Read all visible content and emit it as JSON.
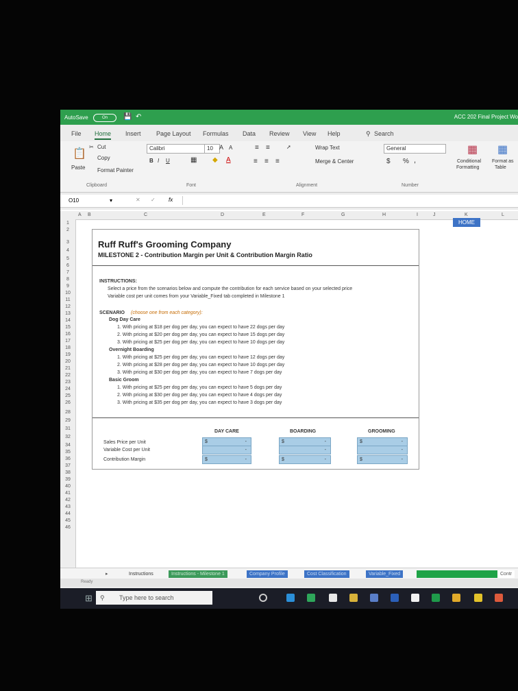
{
  "window": {
    "autosave_label": "AutoSave",
    "autosave_state": "On",
    "title": "ACC 202 Final Project Wo"
  },
  "menu": {
    "file": "File",
    "home": "Home",
    "insert": "Insert",
    "page_layout": "Page Layout",
    "formulas": "Formulas",
    "data": "Data",
    "review": "Review",
    "view": "View",
    "help": "Help",
    "search": "Search"
  },
  "ribbon": {
    "paste": "Paste",
    "cut": "Cut",
    "copy": "Copy",
    "format_painter": "Format Painter",
    "clipboard_label": "Clipboard",
    "font_name": "Calibri",
    "font_size": "10",
    "font_label": "Font",
    "bold": "B",
    "italic": "I",
    "underline": "U",
    "wrap_text": "Wrap Text",
    "merge_center": "Merge & Center",
    "alignment_label": "Alignment",
    "number_format": "General",
    "currency": "$",
    "percent": "%",
    "comma": ",",
    "number_label": "Number",
    "conditional_formatting_1": "Conditional",
    "conditional_formatting_2": "Formatting",
    "format_as_table_1": "Format as",
    "format_as_table_2": "Table"
  },
  "formula_bar": {
    "name_box": "O10",
    "fx": "fx",
    "value": ""
  },
  "columns": [
    "A",
    "B",
    "C",
    "D",
    "E",
    "F",
    "G",
    "H",
    "I",
    "J",
    "K",
    "L"
  ],
  "rows": [
    "1",
    "2",
    "3",
    "4",
    "5",
    "6",
    "7",
    "8",
    "9",
    "10",
    "11",
    "12",
    "13",
    "14",
    "15",
    "16",
    "17",
    "18",
    "19",
    "20",
    "21",
    "22",
    "23",
    "24",
    "25",
    "26",
    "28",
    "29",
    "31",
    "32",
    "34",
    "35",
    "36",
    "37",
    "38",
    "39",
    "40",
    "41",
    "42",
    "43",
    "44",
    "45",
    "46"
  ],
  "sheet": {
    "home_button": "HOME",
    "company": "Ruff Ruff's Grooming Company",
    "milestone": "MILESTONE 2 - Contribution Margin per Unit & Contribution Margin Ratio",
    "instructions_heading": "INSTRUCTIONS:",
    "instructions_line1": "Select a price from the scenarios below and compute the contribution for each service based on your selected price",
    "instructions_line2": "Variable cost per unit comes from your Variable_Fixed tab completed in Milestone 1",
    "scenario_heading": "SCENARIO",
    "scenario_note": "(choose one from each category):",
    "daycare_heading": "Dog Day Care",
    "daycare": [
      "1. With pricing at $18 per dog per day, you can expect to have 22 dogs per day",
      "2. With pricing at $20 per dog per day, you can expect to have 15 dogs per day",
      "3. With pricing at $25 per dog per day, you can expect to have 10 dogs per day"
    ],
    "boarding_heading": "Overnight Boarding",
    "boarding": [
      "1. With pricing at $25 per dog per day, you can expect to have 12 dogs per day",
      "2. With pricing at $28 per dog per day, you can expect to have 10 dogs per day",
      "3. With pricing at $30 per dog per day, you can expect to have 7 dogs per day"
    ],
    "groom_heading": "Basic Groom",
    "groom": [
      "1. With pricing at $25 per dog per day, you can expect to have 5 dogs per day",
      "2. With pricing at $30 per dog per day, you can expect to have 4 dogs per day",
      "3. With pricing at $35 per dog per day, you can expect to have 3 dogs per day"
    ],
    "col_daycare": "DAY CARE",
    "col_boarding": "BOARDING",
    "col_grooming": "GROOMING",
    "row_sales_price": "Sales Price per Unit",
    "row_variable_cost": "Variable Cost per Unit",
    "row_contribution": "Contribution Margin",
    "currency_symbol": "$",
    "dash": "-"
  },
  "tabs": [
    "Instructions",
    "Instructions - Milestone 1",
    "Company Profile",
    "Cost Classification",
    "Variable_Fixed",
    "Contr"
  ],
  "status": {
    "ready": "Ready"
  },
  "taskbar": {
    "search_placeholder": "Type here to search"
  },
  "colors": {
    "excel_green": "#2e9f4e",
    "input_blue": "#a9cde6",
    "home_button": "#3d73c6"
  }
}
